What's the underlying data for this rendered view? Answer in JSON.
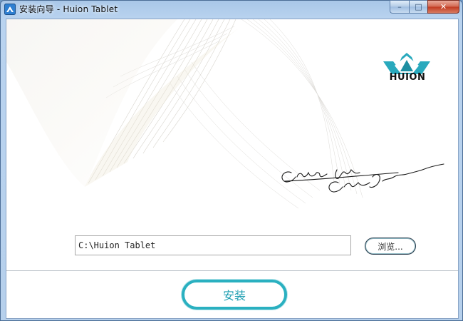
{
  "window": {
    "title": "安装向导 - Huion Tablet",
    "app_icon": "installer-app-icon",
    "caption_buttons": {
      "minimize": "–",
      "maximize": "□",
      "close": "✕"
    }
  },
  "brand": {
    "logo_text": "HUION",
    "logo_icon": "huion-crown-logo-icon",
    "slogan": "Create More Create Different"
  },
  "install_path": {
    "value": "C:\\Huion Tablet",
    "browse_label": "浏览..."
  },
  "install_button": {
    "label": "安装"
  },
  "colors": {
    "accent": "#2ab0c0",
    "frame": "#b9d3ef"
  }
}
